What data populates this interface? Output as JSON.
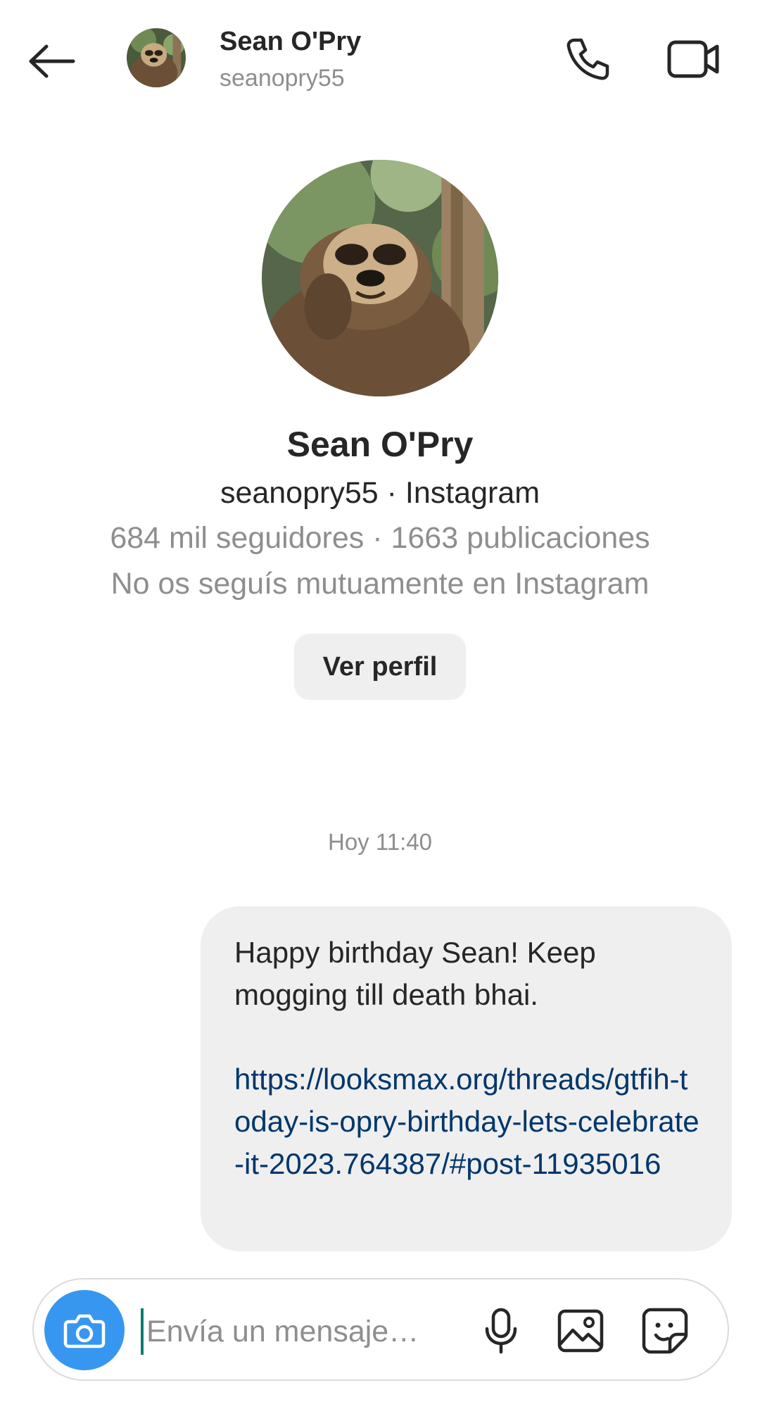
{
  "header": {
    "name": "Sean O'Pry",
    "username": "seanopry55",
    "icons": {
      "back": "back-arrow-icon",
      "call": "phone-icon",
      "video": "video-camera-icon"
    }
  },
  "profile": {
    "name": "Sean O'Pry",
    "subtitle": "seanopry55 · Instagram",
    "stats": "684 mil seguidores · 1663 publicaciones",
    "mutual": "No os seguís mutuamente en Instagram",
    "view_profile_label": "Ver perfil"
  },
  "conversation": {
    "timestamp": "Hoy 11:40",
    "messages": [
      {
        "text": "Happy birthday Sean! Keep mogging till death bhai.",
        "link": "https://looksmax.org/threads/gtfih-today-is-opry-birthday-lets-celebrate-it-2023.764387/#post-11935016"
      }
    ]
  },
  "composer": {
    "placeholder": "Envía un mensaje…",
    "icons": {
      "camera": "camera-icon",
      "mic": "microphone-icon",
      "gallery": "image-gallery-icon",
      "sticker": "sticker-icon"
    }
  },
  "colors": {
    "accent_blue": "#3797f0",
    "link": "#00376b",
    "bubble": "#efefef",
    "secondary_text": "#8e8e8e"
  }
}
